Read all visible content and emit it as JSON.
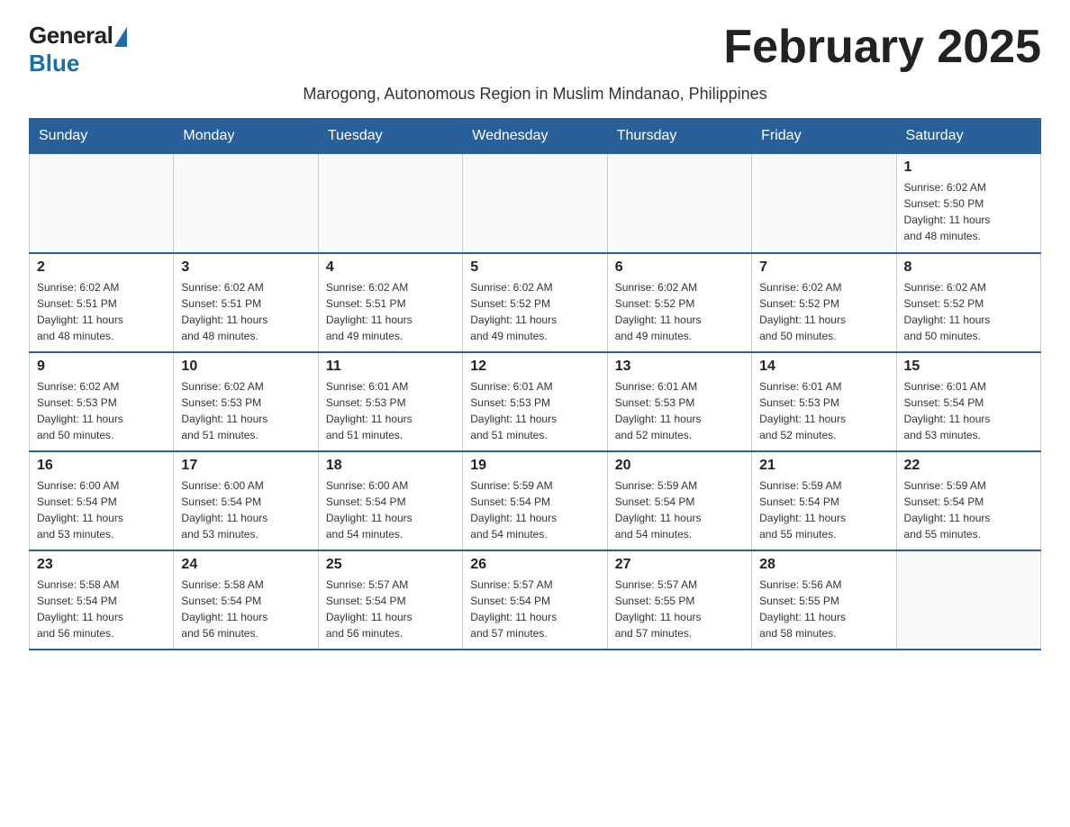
{
  "logo": {
    "general": "General",
    "blue": "Blue"
  },
  "title": "February 2025",
  "subtitle": "Marogong, Autonomous Region in Muslim Mindanao, Philippines",
  "weekdays": [
    "Sunday",
    "Monday",
    "Tuesday",
    "Wednesday",
    "Thursday",
    "Friday",
    "Saturday"
  ],
  "weeks": [
    [
      {
        "day": "",
        "info": ""
      },
      {
        "day": "",
        "info": ""
      },
      {
        "day": "",
        "info": ""
      },
      {
        "day": "",
        "info": ""
      },
      {
        "day": "",
        "info": ""
      },
      {
        "day": "",
        "info": ""
      },
      {
        "day": "1",
        "info": "Sunrise: 6:02 AM\nSunset: 5:50 PM\nDaylight: 11 hours\nand 48 minutes."
      }
    ],
    [
      {
        "day": "2",
        "info": "Sunrise: 6:02 AM\nSunset: 5:51 PM\nDaylight: 11 hours\nand 48 minutes."
      },
      {
        "day": "3",
        "info": "Sunrise: 6:02 AM\nSunset: 5:51 PM\nDaylight: 11 hours\nand 48 minutes."
      },
      {
        "day": "4",
        "info": "Sunrise: 6:02 AM\nSunset: 5:51 PM\nDaylight: 11 hours\nand 49 minutes."
      },
      {
        "day": "5",
        "info": "Sunrise: 6:02 AM\nSunset: 5:52 PM\nDaylight: 11 hours\nand 49 minutes."
      },
      {
        "day": "6",
        "info": "Sunrise: 6:02 AM\nSunset: 5:52 PM\nDaylight: 11 hours\nand 49 minutes."
      },
      {
        "day": "7",
        "info": "Sunrise: 6:02 AM\nSunset: 5:52 PM\nDaylight: 11 hours\nand 50 minutes."
      },
      {
        "day": "8",
        "info": "Sunrise: 6:02 AM\nSunset: 5:52 PM\nDaylight: 11 hours\nand 50 minutes."
      }
    ],
    [
      {
        "day": "9",
        "info": "Sunrise: 6:02 AM\nSunset: 5:53 PM\nDaylight: 11 hours\nand 50 minutes."
      },
      {
        "day": "10",
        "info": "Sunrise: 6:02 AM\nSunset: 5:53 PM\nDaylight: 11 hours\nand 51 minutes."
      },
      {
        "day": "11",
        "info": "Sunrise: 6:01 AM\nSunset: 5:53 PM\nDaylight: 11 hours\nand 51 minutes."
      },
      {
        "day": "12",
        "info": "Sunrise: 6:01 AM\nSunset: 5:53 PM\nDaylight: 11 hours\nand 51 minutes."
      },
      {
        "day": "13",
        "info": "Sunrise: 6:01 AM\nSunset: 5:53 PM\nDaylight: 11 hours\nand 52 minutes."
      },
      {
        "day": "14",
        "info": "Sunrise: 6:01 AM\nSunset: 5:53 PM\nDaylight: 11 hours\nand 52 minutes."
      },
      {
        "day": "15",
        "info": "Sunrise: 6:01 AM\nSunset: 5:54 PM\nDaylight: 11 hours\nand 53 minutes."
      }
    ],
    [
      {
        "day": "16",
        "info": "Sunrise: 6:00 AM\nSunset: 5:54 PM\nDaylight: 11 hours\nand 53 minutes."
      },
      {
        "day": "17",
        "info": "Sunrise: 6:00 AM\nSunset: 5:54 PM\nDaylight: 11 hours\nand 53 minutes."
      },
      {
        "day": "18",
        "info": "Sunrise: 6:00 AM\nSunset: 5:54 PM\nDaylight: 11 hours\nand 54 minutes."
      },
      {
        "day": "19",
        "info": "Sunrise: 5:59 AM\nSunset: 5:54 PM\nDaylight: 11 hours\nand 54 minutes."
      },
      {
        "day": "20",
        "info": "Sunrise: 5:59 AM\nSunset: 5:54 PM\nDaylight: 11 hours\nand 54 minutes."
      },
      {
        "day": "21",
        "info": "Sunrise: 5:59 AM\nSunset: 5:54 PM\nDaylight: 11 hours\nand 55 minutes."
      },
      {
        "day": "22",
        "info": "Sunrise: 5:59 AM\nSunset: 5:54 PM\nDaylight: 11 hours\nand 55 minutes."
      }
    ],
    [
      {
        "day": "23",
        "info": "Sunrise: 5:58 AM\nSunset: 5:54 PM\nDaylight: 11 hours\nand 56 minutes."
      },
      {
        "day": "24",
        "info": "Sunrise: 5:58 AM\nSunset: 5:54 PM\nDaylight: 11 hours\nand 56 minutes."
      },
      {
        "day": "25",
        "info": "Sunrise: 5:57 AM\nSunset: 5:54 PM\nDaylight: 11 hours\nand 56 minutes."
      },
      {
        "day": "26",
        "info": "Sunrise: 5:57 AM\nSunset: 5:54 PM\nDaylight: 11 hours\nand 57 minutes."
      },
      {
        "day": "27",
        "info": "Sunrise: 5:57 AM\nSunset: 5:55 PM\nDaylight: 11 hours\nand 57 minutes."
      },
      {
        "day": "28",
        "info": "Sunrise: 5:56 AM\nSunset: 5:55 PM\nDaylight: 11 hours\nand 58 minutes."
      },
      {
        "day": "",
        "info": ""
      }
    ]
  ]
}
